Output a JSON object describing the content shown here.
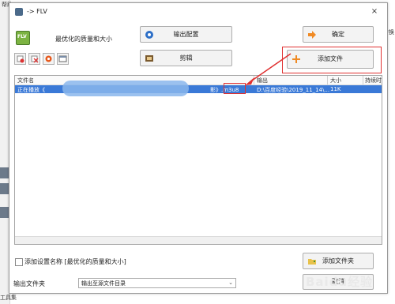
{
  "background": {
    "help_menu": "帮助",
    "toolbox_label": "工具集",
    "right_edge_text": "格转换状"
  },
  "dialog": {
    "title": "-> FLV",
    "close_glyph": "×",
    "format_icon_text": "FLV",
    "quality_text": "最优化的质量和大小",
    "output_config_label": "输出配置",
    "ok_label": "确定",
    "edit_label": "剪辑",
    "add_file_label": "添加文件",
    "add_folder_label": "添加文件夹",
    "cancel_label": "取消"
  },
  "table": {
    "headers": [
      "文件名",
      "输出",
      "大小",
      "持续时"
    ],
    "rows": [
      {
        "name": "正在播放《",
        "suffix": "影》.m3u8",
        "output": "D:\\百度经验\\2019_11_14\\...",
        "size": "11K"
      }
    ]
  },
  "options": {
    "add_setting_name_label": "添加设置名称 [最优化的质量和大小]",
    "output_folder_label": "输出文件夹",
    "output_folder_value": "输出至源文件目录",
    "dropdown_arrow": "⌄"
  },
  "watermark_text": "Baidu经验",
  "colors": {
    "selection": "#3a79d7",
    "highlight_red": "#e03131",
    "add_icon_orange": "#f08a24"
  }
}
